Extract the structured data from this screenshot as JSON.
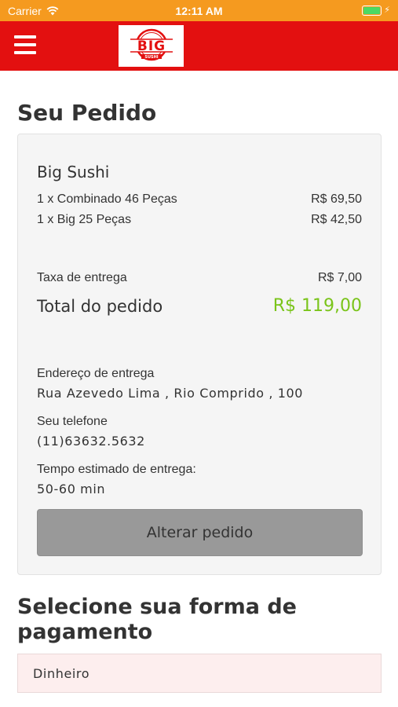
{
  "status_bar": {
    "carrier": "Carrier",
    "time": "12:11 AM"
  },
  "header": {
    "logo_text": "BIG",
    "logo_subtext": "SUSHI",
    "brand_color": "#e31010"
  },
  "order": {
    "title": "Seu Pedido",
    "store_name": "Big Sushi",
    "items": [
      {
        "label": "1 x Combinado 46 Peças",
        "price": "R$ 69,50"
      },
      {
        "label": "1 x Big 25 Peças",
        "price": "R$ 42,50"
      }
    ],
    "fee_label": "Taxa de entrega",
    "fee_value": "R$ 7,00",
    "total_label": "Total do pedido",
    "total_value": "R$ 119,00",
    "total_color": "#7ac41a",
    "address_label": "Endereço de entrega",
    "address_value": "Rua Azevedo Lima , Rio Comprido , 100",
    "phone_label": "Seu telefone",
    "phone_value": "(11)63632.5632",
    "time_label": "Tempo estimado de entrega:",
    "time_value": "50-60 min",
    "change_button": "Alterar pedido"
  },
  "payment": {
    "title": "Selecione sua forma de pagamento",
    "options": [
      {
        "label": "Dinheiro"
      }
    ]
  }
}
